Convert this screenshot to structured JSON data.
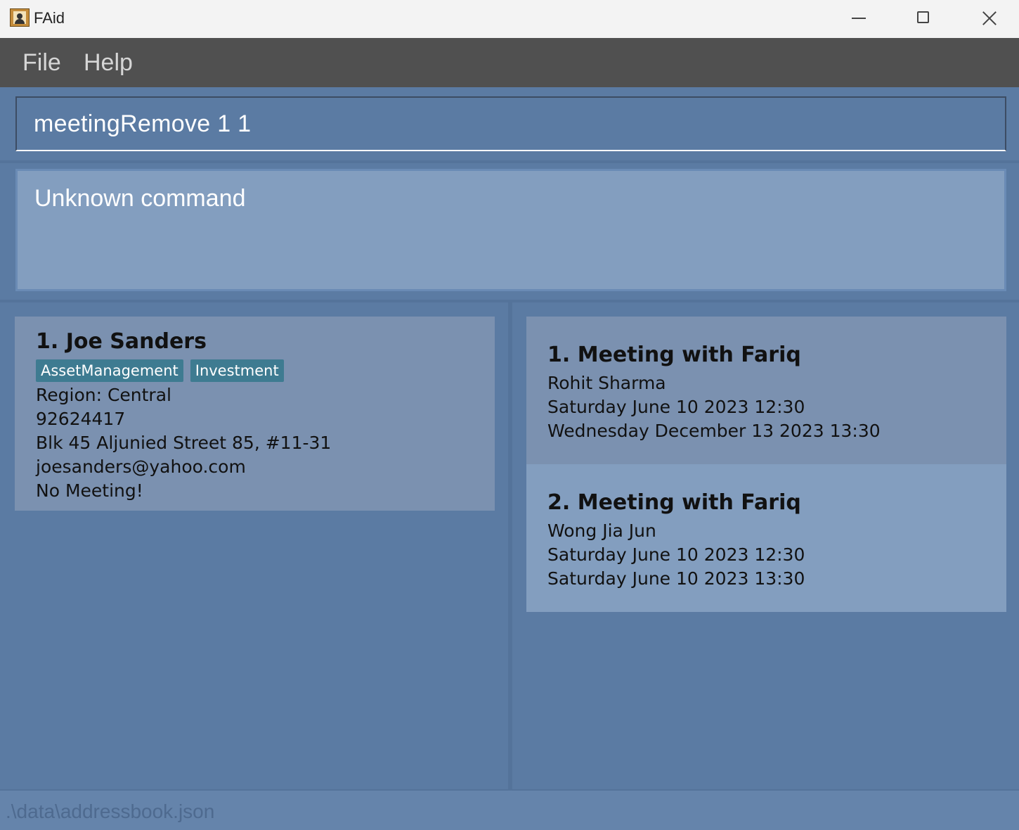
{
  "window": {
    "title": "FAid",
    "icon": "contact-book-icon",
    "minimize_icon": "minimize-icon",
    "maximize_icon": "maximize-icon",
    "close_icon": "close-icon"
  },
  "menu": {
    "file": "File",
    "help": "Help"
  },
  "command": {
    "value": "meetingRemove 1 1"
  },
  "result": {
    "message": "Unknown command"
  },
  "persons": [
    {
      "title": "1.  Joe Sanders",
      "tags": [
        "AssetManagement",
        "Investment"
      ],
      "region": "Region: Central",
      "phone": "92624417",
      "address": "Blk 45 Aljunied Street 85, #11-31",
      "email": "joesanders@yahoo.com",
      "meeting": "No Meeting!"
    }
  ],
  "meetings": [
    {
      "title": "1.  Meeting with Fariq",
      "attendee": "Rohit Sharma",
      "start": "Saturday June 10 2023 12:30",
      "end": "Wednesday December 13 2023 13:30"
    },
    {
      "title": "2.  Meeting with Fariq",
      "attendee": "Wong Jia Jun",
      "start": "Saturday June 10 2023 12:30",
      "end": "Saturday June 10 2023 13:30"
    }
  ],
  "status": {
    "path": ".\\data\\addressbook.json"
  },
  "colors": {
    "background": "#5b7ba3",
    "menubar": "#505050",
    "card_dark": "#7b91b0",
    "card_light": "#839ebf",
    "tag": "#3e7b91"
  }
}
